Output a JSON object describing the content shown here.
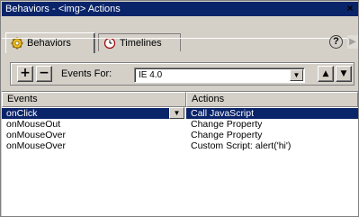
{
  "window": {
    "title": "Behaviors - <img> Actions",
    "close_glyph": "×"
  },
  "tabs": [
    {
      "label": "Behaviors",
      "icon": "gear-icon",
      "active": true
    },
    {
      "label": "Timelines",
      "icon": "clock-icon",
      "active": false
    }
  ],
  "toolbar": {
    "add_glyph": "+",
    "remove_glyph": "−",
    "events_for_label": "Events For:",
    "events_for_value": "IE 4.0",
    "up_glyph": "▲",
    "down_glyph": "▼"
  },
  "table": {
    "columns": [
      "Events",
      "Actions"
    ],
    "rows": [
      {
        "event": "onClick",
        "action": "Call JavaScript",
        "selected": true
      },
      {
        "event": "onMouseOut",
        "action": "Change Property",
        "selected": false
      },
      {
        "event": "onMouseOver",
        "action": "Change Property",
        "selected": false
      },
      {
        "event": "onMouseOver",
        "action": "Custom Script: alert('hi')",
        "selected": false
      }
    ]
  },
  "icons": {
    "help": "help-icon",
    "panel_arrow": "arrow-right-icon"
  },
  "colors": {
    "titlebar": "#0a246a",
    "selection": "#0a246a",
    "panel": "#d4d0c8"
  }
}
